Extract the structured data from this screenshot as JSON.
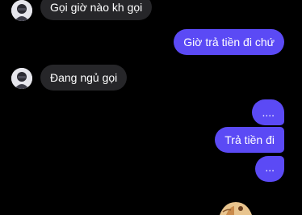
{
  "theme": {
    "background": "#000000",
    "incoming_bubble": "#262629",
    "incoming_text": "#ffffff",
    "outgoing_bubble": "#5b4af5",
    "outgoing_text": "#ffffff"
  },
  "messages": [
    {
      "direction": "incoming",
      "avatar": "contact-avatar",
      "text": "Gọi giờ nào kh gọi"
    },
    {
      "direction": "outgoing",
      "text": "Giờ trả tiền đi chứ"
    },
    {
      "direction": "incoming",
      "avatar": "contact-avatar",
      "text": "Đang ngủ gọi"
    },
    {
      "direction": "outgoing",
      "text": "...."
    },
    {
      "direction": "outgoing",
      "text": "Trả tiền đi"
    },
    {
      "direction": "outgoing",
      "text": "..."
    }
  ],
  "sticker": {
    "icon": "sticker-image"
  }
}
